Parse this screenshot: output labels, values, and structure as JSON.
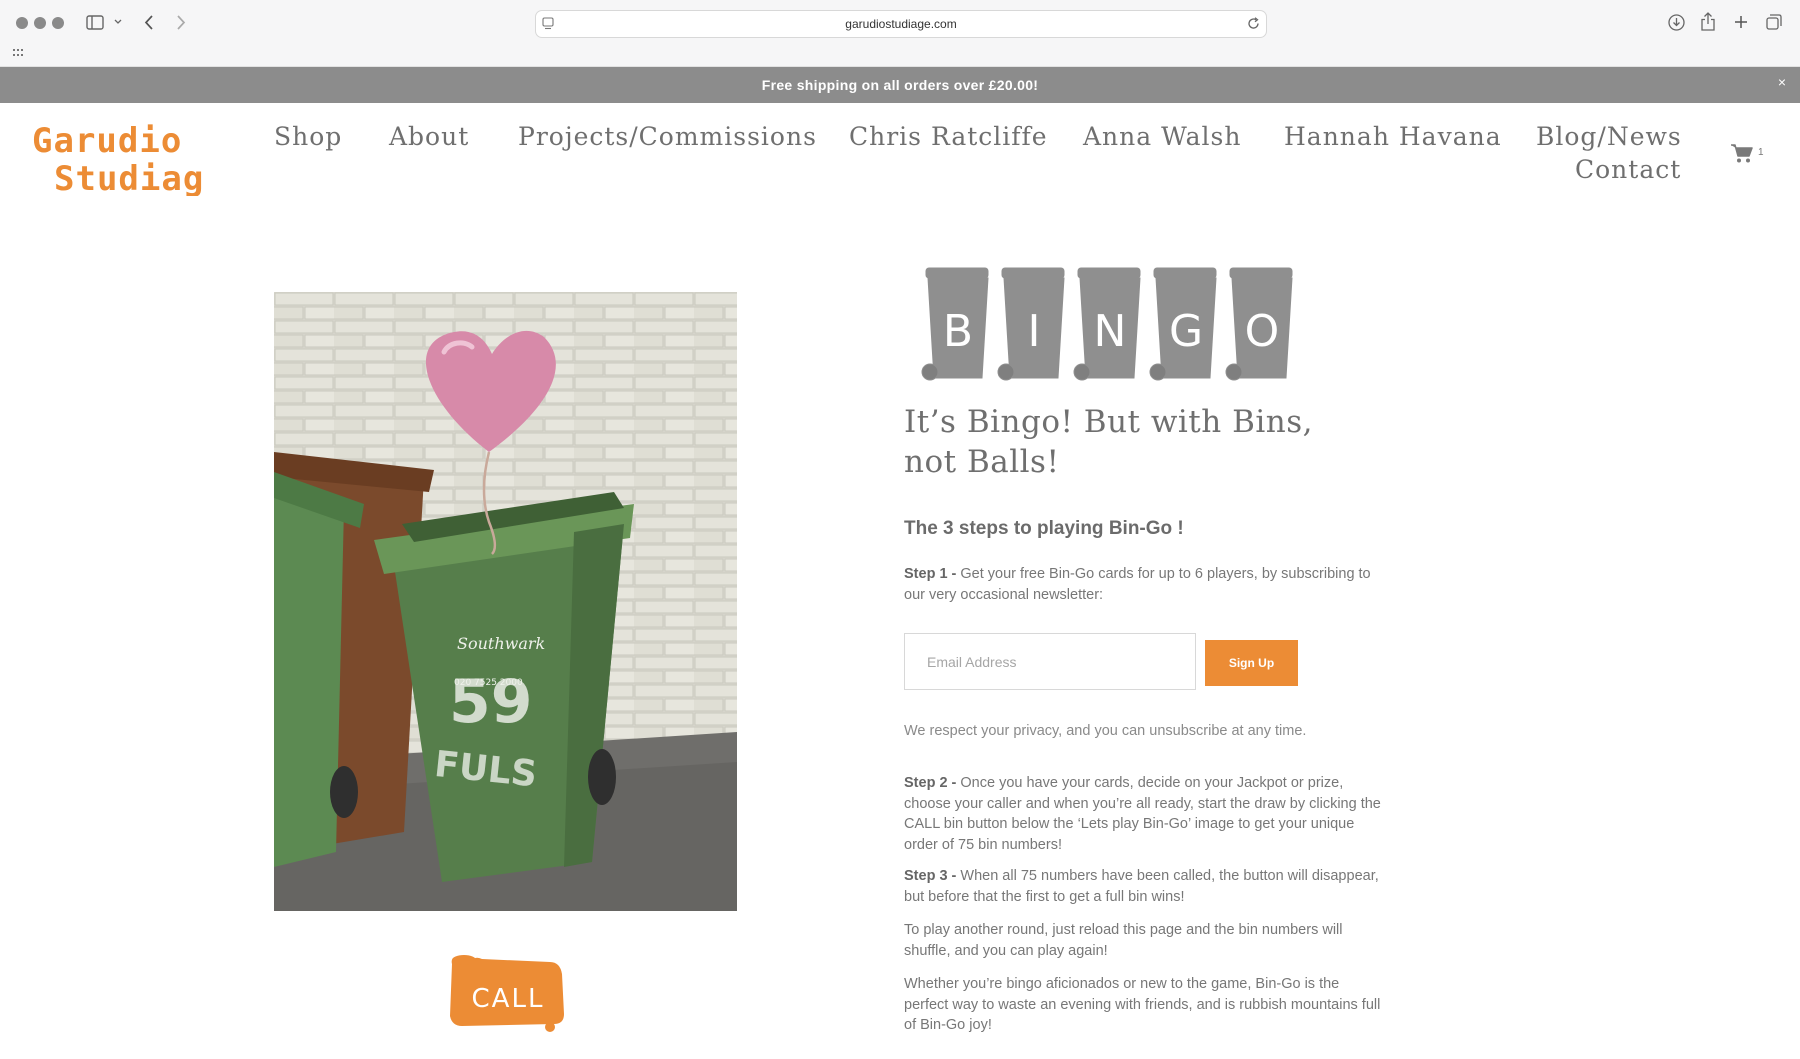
{
  "browser": {
    "url": "garudiostudiage.com",
    "icons": [
      "sidebar-icon",
      "chevron-down-icon",
      "back-icon",
      "forward-icon",
      "page-icon",
      "reload-icon",
      "download-icon",
      "share-icon",
      "new-tab-icon",
      "tabs-overview-icon",
      "apps-grid-icon"
    ]
  },
  "announcement": {
    "text": "Free shipping on all orders over £20.00!",
    "close": "×"
  },
  "logo": {
    "line1": "Garudio",
    "line2": "Studiage",
    "color": "#ec8c35"
  },
  "nav": {
    "items": [
      "Shop",
      "About",
      "Projects/Commissions",
      "Chris Ratcliffe",
      "Anna Walsh",
      "Hannah Havana",
      "Blog/News",
      "Contact"
    ]
  },
  "cart": {
    "count": "1"
  },
  "bingo_logo": {
    "letters": [
      "B",
      "I",
      "N",
      "G",
      "O"
    ]
  },
  "call_button": {
    "label": "CALL"
  },
  "content": {
    "headline": "It’s Bingo!  But with Bins, not Balls!",
    "steps_title": "The 3 steps to playing Bin-Go !",
    "step1_label": "Step 1 -",
    "step1_text": " Get your free Bin-Go cards for up to 6 players, by subscribing to our very occasional newsletter:",
    "email_placeholder": "Email Address",
    "signup_label": "Sign Up",
    "privacy": "We respect your privacy, and you can unsubscribe at any time.",
    "step2_label": "Step 2 -",
    "step2_text": " Once you have your cards, decide on your Jackpot or prize, choose your caller and when you’re all ready, start the draw by clicking the CALL bin button below the ‘Lets play Bin-Go’ image to get your unique order of 75 bin numbers!",
    "step3_label": "Step 3 -",
    "step3_text": " When all 75 numbers have been called, the button will disappear, but before that the first to get a full bin wins!",
    "replay": "To play another round, just reload this page and the bin numbers will shuffle, and you can play again!",
    "closing": "Whether you’re bingo aficionados or new to the game, Bin-Go is the perfect way to waste an evening with friends, and is rubbish mountains full of Bin-Go joy!"
  },
  "colors": {
    "accent": "#ec8c35",
    "announcement_bg": "#8c8c8c",
    "text": "#777777"
  }
}
